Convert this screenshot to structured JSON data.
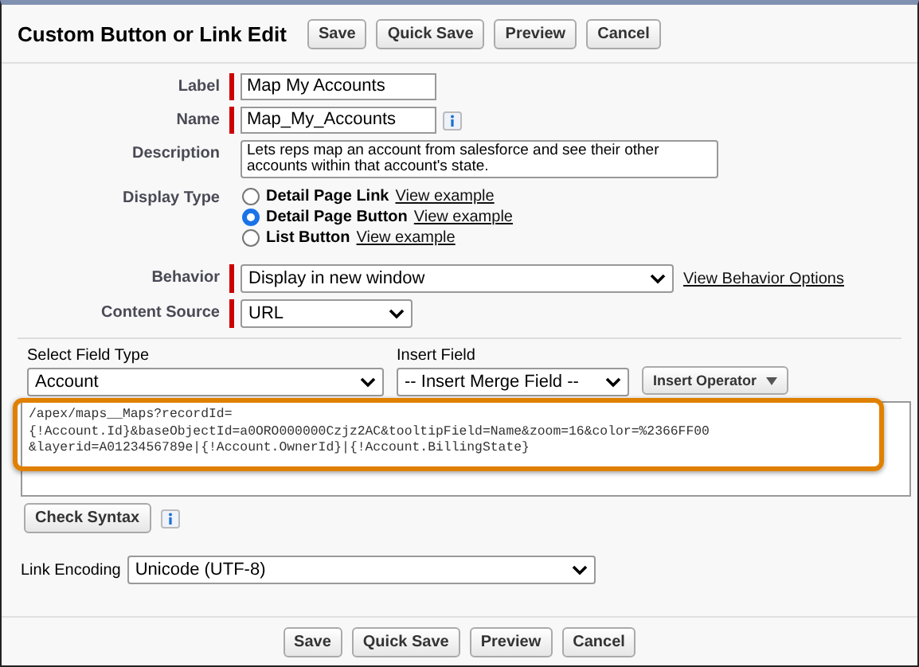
{
  "header": {
    "title": "Custom Button or Link Edit",
    "buttons": [
      "Save",
      "Quick Save",
      "Preview",
      "Cancel"
    ]
  },
  "fields": [
    {
      "label": "Label",
      "kind": "text",
      "required": true,
      "value": "Map My Accounts",
      "info": false
    },
    {
      "label": "Name",
      "kind": "text",
      "required": true,
      "value": "Map_My_Accounts",
      "info": true
    },
    {
      "label": "Description",
      "kind": "textarea",
      "required": false,
      "value": "Lets reps map an account from salesforce and see their other accounts within that account's state.",
      "info": false
    }
  ],
  "display_type": {
    "label": "Display Type",
    "options": [
      {
        "label": "Detail Page Link",
        "link": "View example",
        "selected": false
      },
      {
        "label": "Detail Page Button",
        "link": "View example",
        "selected": true
      },
      {
        "label": "List Button",
        "link": "View example",
        "selected": false
      }
    ]
  },
  "selects": [
    {
      "label": "Behavior",
      "value": "Display in new window",
      "required": true,
      "wide": true,
      "link": "View Behavior Options"
    },
    {
      "label": "Content Source",
      "value": "URL",
      "required": true,
      "wide": false
    }
  ],
  "formula": {
    "field_type_label": "Select Field Type",
    "field_type": "Account",
    "insert_field_label": "Insert Field",
    "insert_field": "-- Insert Merge Field --",
    "operator_button": "Insert Operator",
    "lines": [
      "/apex/maps__Maps?recordId=",
      "{!Account.Id}&baseObjectId=a0ORO000000Czjz2AC&tooltipField=Name&zoom=16&color=%2366FF00",
      "&layerid=A0123456789e|{!Account.OwnerId}|{!Account.BillingState}"
    ],
    "highlighted": true,
    "check_button": "Check Syntax"
  },
  "link_encoding": {
    "label": "Link Encoding",
    "value": "Unicode (UTF-8)"
  },
  "footer": {
    "buttons": [
      "Save",
      "Quick Save",
      "Preview",
      "Cancel"
    ]
  }
}
